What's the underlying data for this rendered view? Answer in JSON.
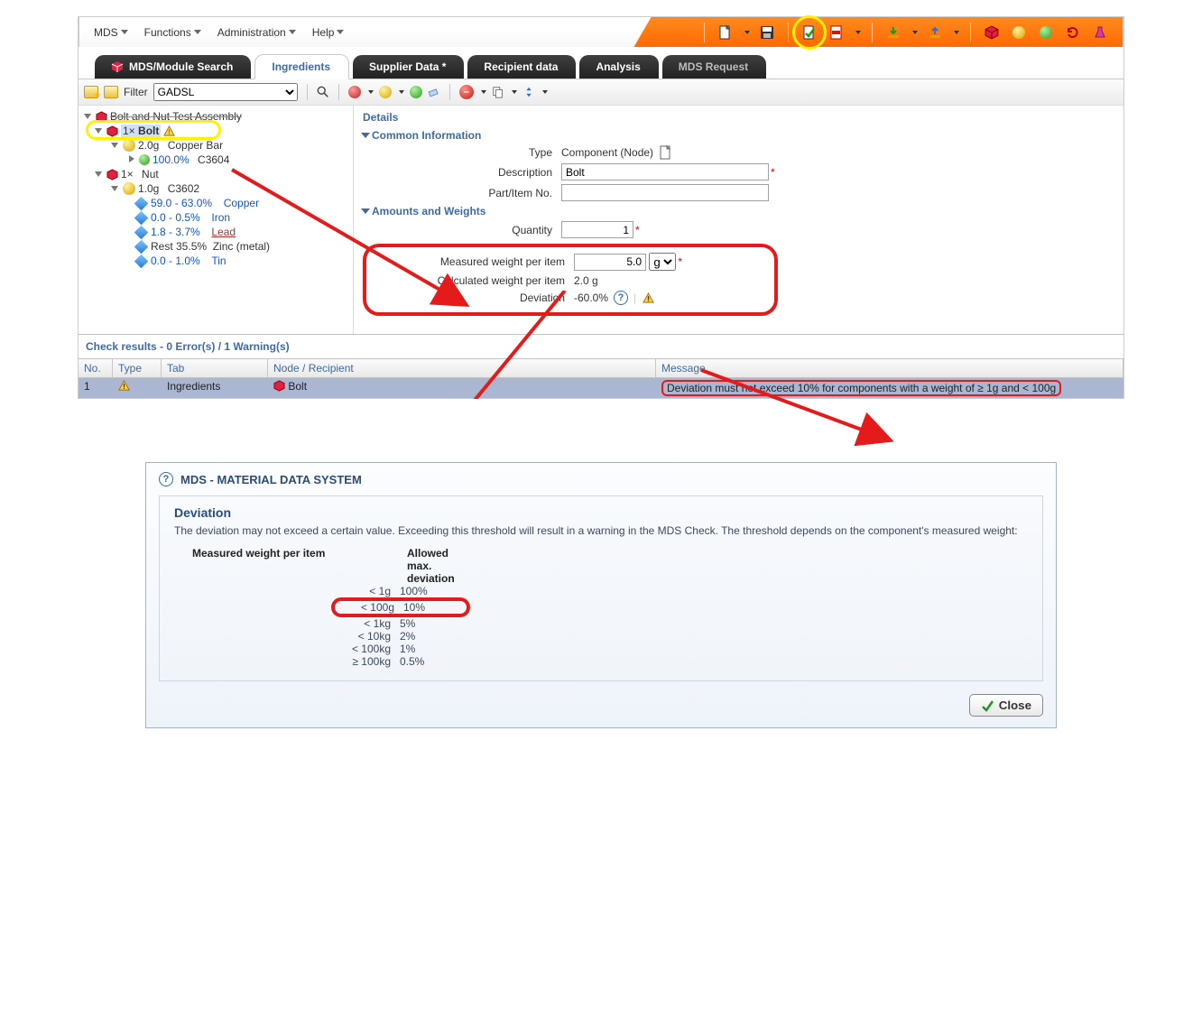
{
  "menu": {
    "mds": "MDS",
    "functions": "Functions",
    "administration": "Administration",
    "help": "Help"
  },
  "tabs": {
    "search": "MDS/Module Search",
    "ingredients": "Ingredients",
    "supplier": "Supplier Data *",
    "recipient": "Recipient data",
    "analysis": "Analysis",
    "request": "MDS Request"
  },
  "toolbar2": {
    "filter_label": "Filter",
    "filter_value": "GADSL"
  },
  "tree": {
    "root": "Bolt and Nut Test Assembly",
    "bolt_qty": "1×",
    "bolt": "Bolt",
    "copper_bar_w": "2.0g",
    "copper_bar": "Copper Bar",
    "c3604_pct": "100.0%",
    "c3604": "C3604",
    "nut_qty": "1×",
    "nut": "Nut",
    "c3602_w": "1.0g",
    "c3602": "C3602",
    "sub": [
      {
        "range": "59.0 - 63.0%",
        "name": "Copper"
      },
      {
        "range": "0.0 - 0.5%",
        "name": "Iron"
      },
      {
        "range": "1.8 - 3.7%",
        "name": "Lead",
        "lead": true
      },
      {
        "range": "Rest 35.5%",
        "name": "Zinc (metal)",
        "rest": true
      },
      {
        "range": "0.0 - 1.0%",
        "name": "Tin"
      }
    ]
  },
  "details": {
    "heading": "Details",
    "common": "Common Information",
    "type_label": "Type",
    "type_value": "Component (Node)",
    "desc_label": "Description",
    "desc_value": "Bolt",
    "part_label": "Part/Item No.",
    "part_value": "",
    "amounts_head": "Amounts and Weights",
    "qty_label": "Quantity",
    "qty_value": "1",
    "mw_label": "Measured weight per item",
    "mw_value": "5.0",
    "mw_unit": "g",
    "cw_label": "Calculated weight per item",
    "cw_value": "2.0  g",
    "dev_label": "Deviation",
    "dev_value": "-60.0%"
  },
  "check": {
    "head": "Check results - 0 Error(s) / 1 Warning(s)",
    "cols": {
      "no": "No.",
      "type": "Type",
      "tab": "Tab",
      "node": "Node / Recipient",
      "msg": "Message"
    },
    "row": {
      "no": "1",
      "tab": "Ingredients",
      "node": "Bolt",
      "msg": "Deviation must not exceed 10% for components with a weight of ≥ 1g and < 100g"
    }
  },
  "dialog": {
    "title": "MDS - MATERIAL DATA SYSTEM",
    "h": "Deviation",
    "p": "The deviation may not exceed a certain value. Exceeding this threshold will result in a warning in the MDS Check. The threshold depends on the component's measured weight:",
    "col_w": "Measured weight per item",
    "col_m": "Allowed max. deviation",
    "rows": [
      {
        "w": "< 1g",
        "m": "100%"
      },
      {
        "w": "< 100g",
        "m": "10%",
        "hl": true
      },
      {
        "w": "< 1kg",
        "m": "5%"
      },
      {
        "w": "< 10kg",
        "m": "2%"
      },
      {
        "w": "< 100kg",
        "m": "1%"
      },
      {
        "w": "≥ 100kg",
        "m": "0.5%"
      }
    ],
    "close": "Close"
  }
}
